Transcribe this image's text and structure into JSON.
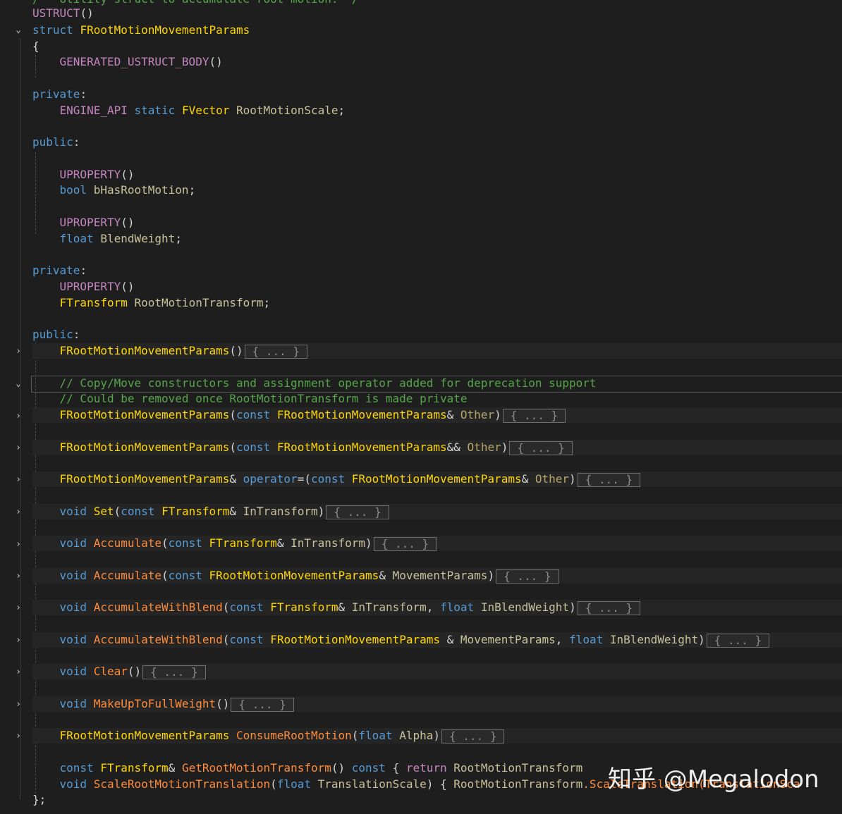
{
  "editor": {
    "comment_top": "/** Utility struct to accumulate root motion. */",
    "lines": {
      "l_ustruct": "USTRUCT",
      "l_struct_kw": "struct",
      "l_struct_name": "FRootMotionMovementParams",
      "l_brace_open": "{",
      "l_gen": "GENERATED_USTRUCT_BODY",
      "l_private1": "private",
      "l_engine_api": "ENGINE_API",
      "l_static": "static",
      "l_fvector": "FVector",
      "l_rms": "RootMotionScale",
      "l_public1": "public",
      "l_uprop": "UPROPERTY",
      "l_bool": "bool",
      "l_bhas": "bHasRootMotion",
      "l_float": "float",
      "l_blend": "BlendWeight",
      "l_private2": "private",
      "l_ftransform": "FTransform",
      "l_rmt": "RootMotionTransform",
      "l_public2": "public",
      "l_ctor": "FRootMotionMovementParams",
      "c1": "// Copy/Move constructors and assignment operator added for deprecation support",
      "c2": "// Could be removed once RootMotionTransform is made private",
      "const": "const",
      "other": "Other",
      "operator": "operator",
      "void": "void",
      "set": "Set",
      "intransform": "InTransform",
      "accumulate": "Accumulate",
      "movementparams": "MovementParams",
      "accblend": "AccumulateWithBlend",
      "inblend": "InBlendWeight",
      "clear": "Clear",
      "makeup": "MakeUpToFullWeight",
      "consume": "ConsumeRootMotion",
      "alpha": "Alpha",
      "getrmt": "GetRootMotionTransform",
      "return": "return",
      "scalermt": "ScaleRootMotionTranslation",
      "translationscale": "TranslationScale",
      "scaletrans_tail": ".ScaleTranslation(TranslationSca",
      "brace_close": "};"
    },
    "collapsed_label": "{ ... }",
    "fold_expanded": "⌄",
    "fold_collapsed": "›"
  },
  "watermark": {
    "text": "知乎 @Megalodon"
  }
}
